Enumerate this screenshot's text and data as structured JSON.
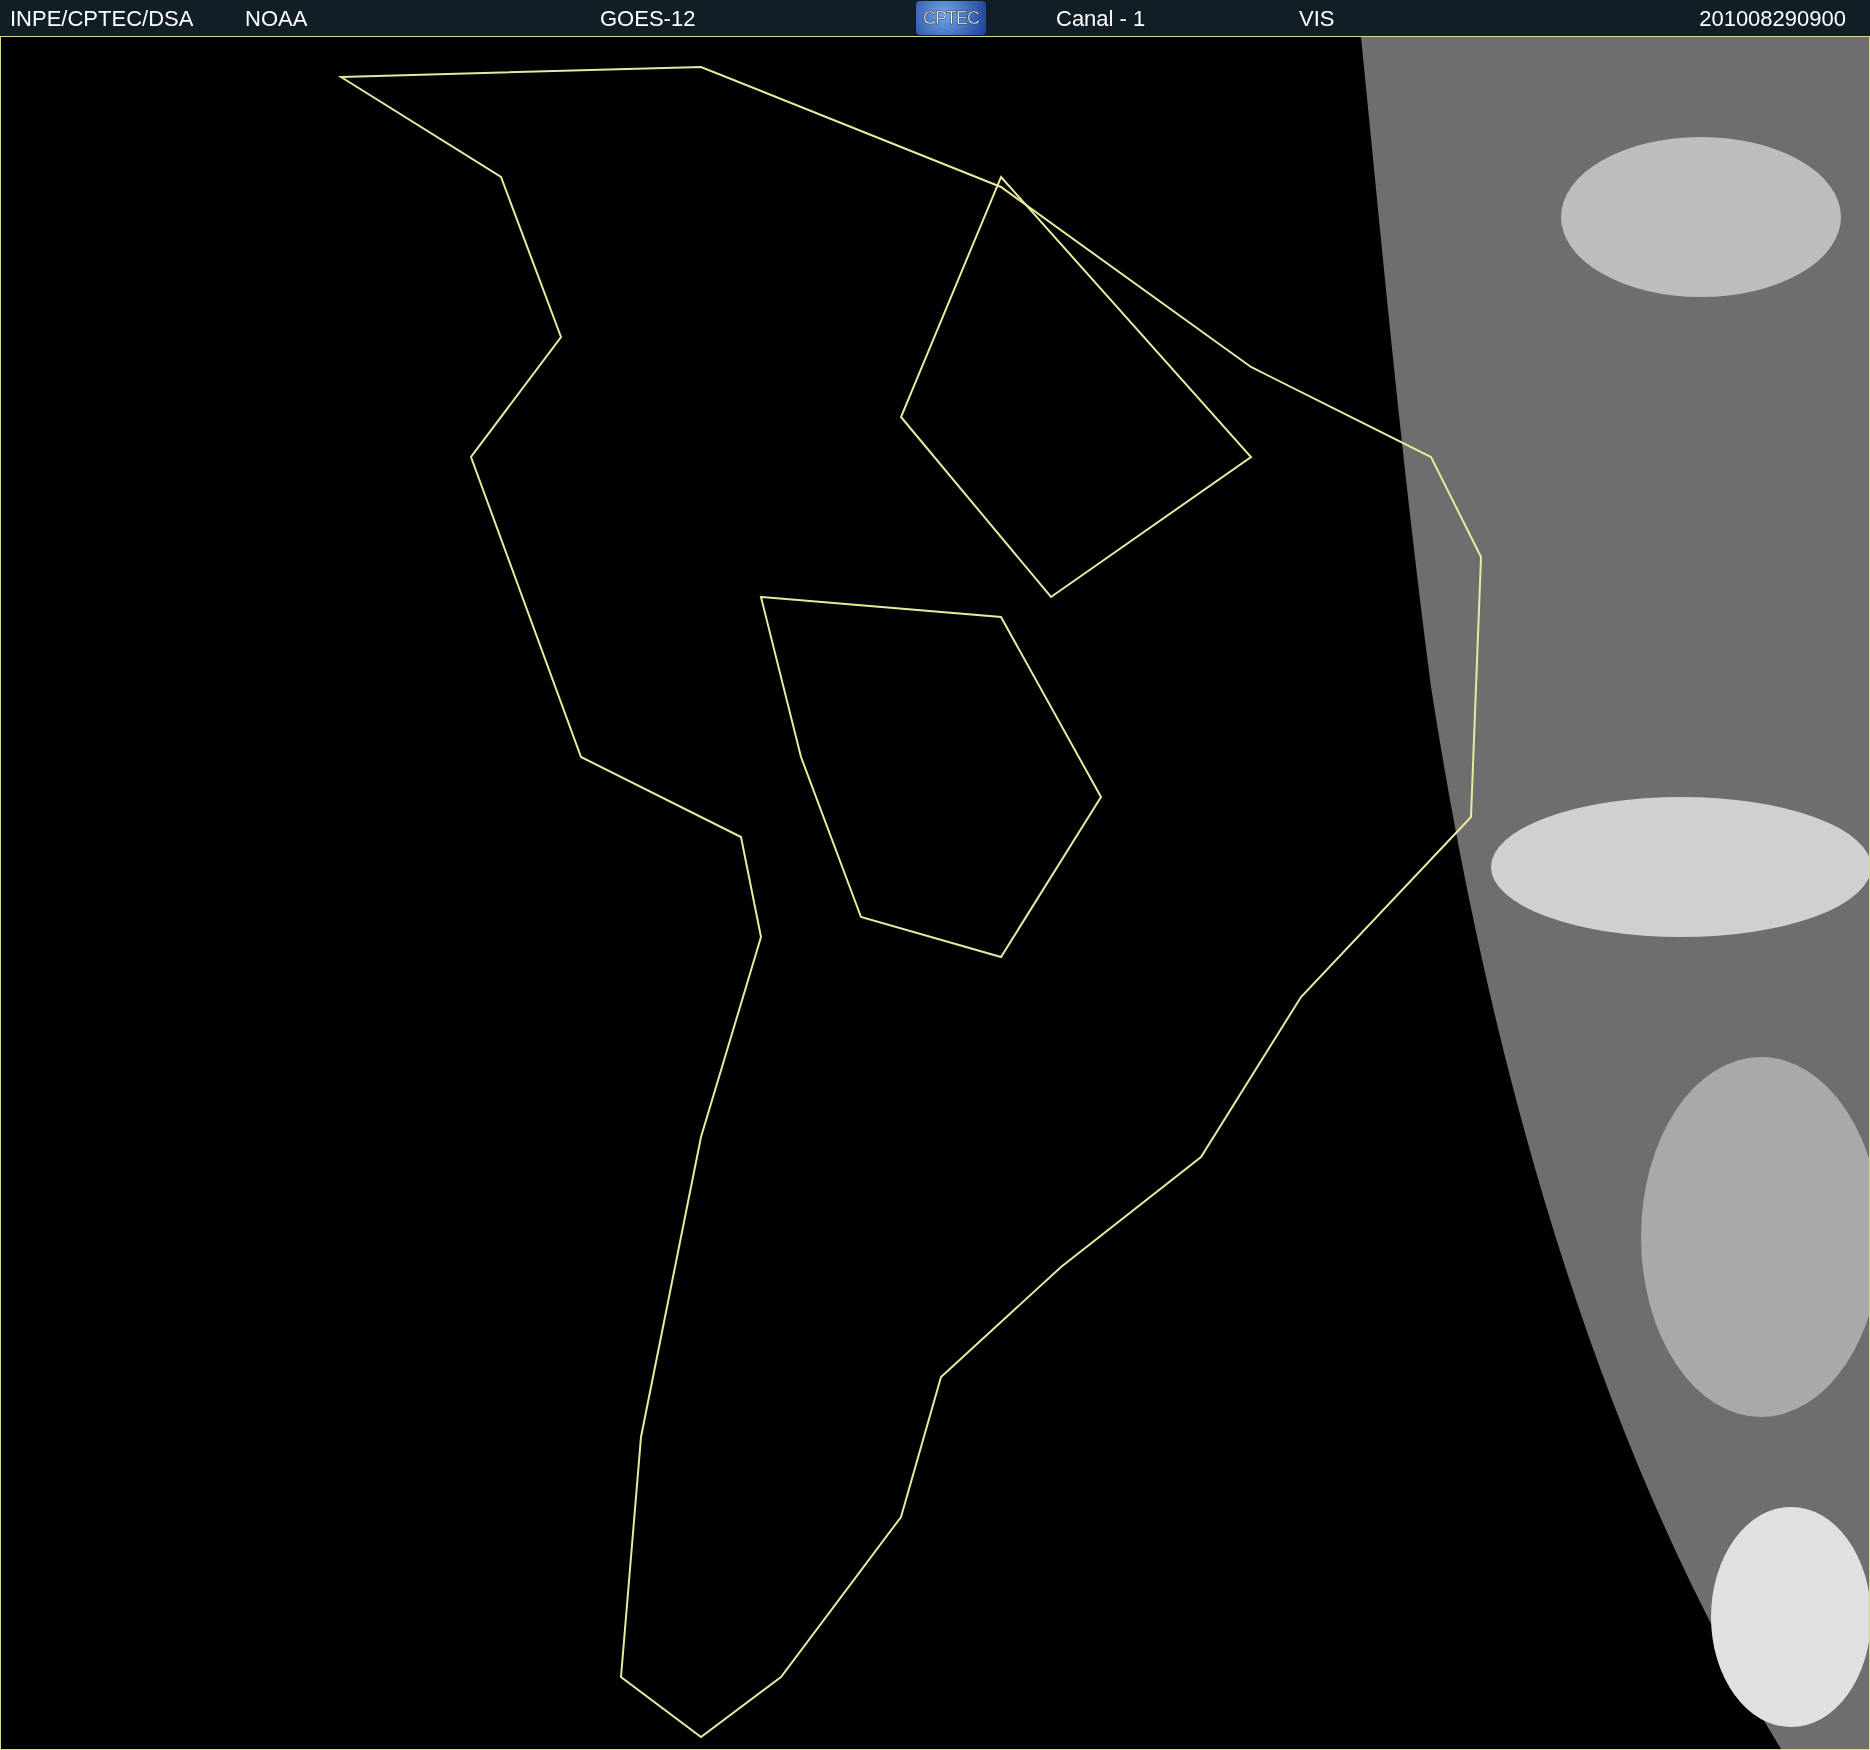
{
  "header": {
    "items": [
      {
        "kind": "text",
        "text": "INPE/CPTEC/DSA"
      },
      {
        "kind": "text",
        "text": "NOAA"
      },
      {
        "kind": "text",
        "text": "GOES-12"
      },
      {
        "kind": "logo",
        "text": "CPTEC"
      },
      {
        "kind": "text",
        "text": "Canal - 1"
      },
      {
        "kind": "text",
        "text": "VIS"
      },
      {
        "kind": "text",
        "text": "201008290900"
      }
    ]
  }
}
